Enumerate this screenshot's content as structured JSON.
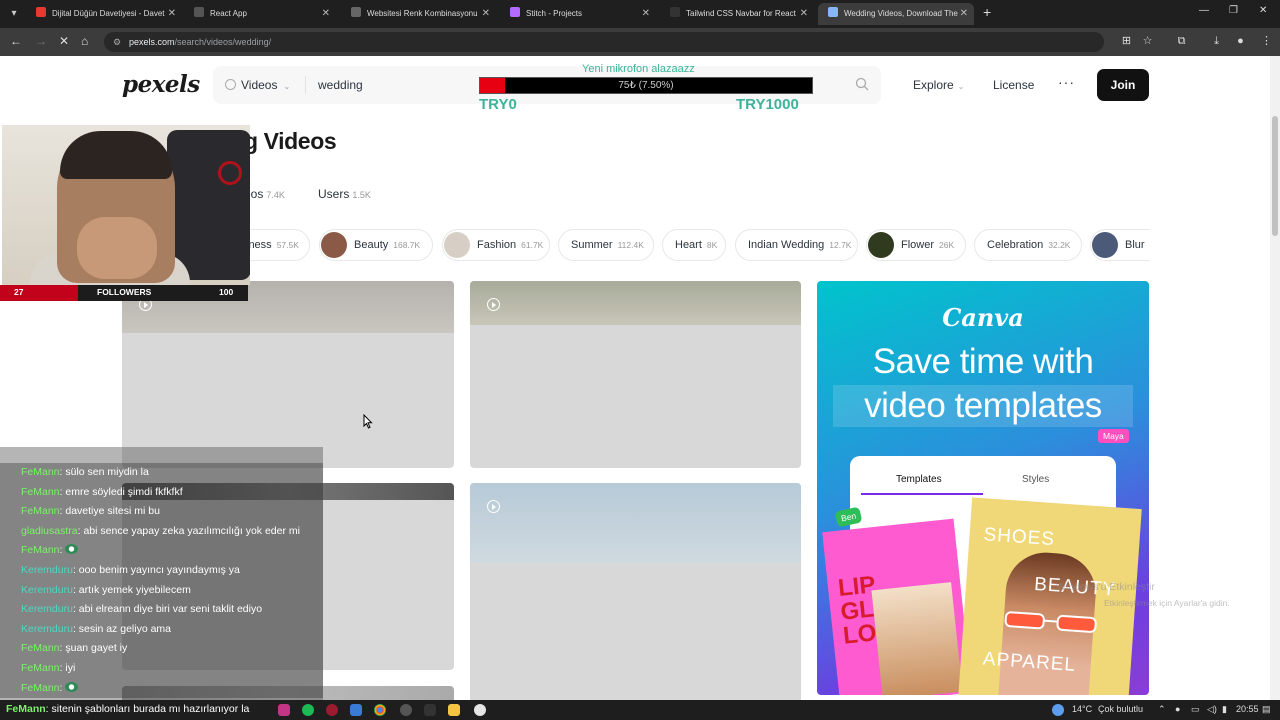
{
  "browser": {
    "tabs": [
      {
        "title": "Dijital Düğün Davetiyesi - Davet",
        "color": "#e53935",
        "active": false
      },
      {
        "title": "React App",
        "color": "#555555",
        "active": false
      },
      {
        "title": "Websitesi Renk Kombinasyonu",
        "color": "#666666",
        "active": false
      },
      {
        "title": "Stitch - Projects",
        "color": "#b36bff",
        "active": false
      },
      {
        "title": "Tailwind CSS Navbar for React",
        "color": "#333333",
        "active": false
      },
      {
        "title": "Wedding Videos, Download The",
        "color": "#8ab4f8",
        "active": true
      }
    ],
    "url_host": "pexels.com",
    "url_path": "/search/videos/wedding/"
  },
  "header": {
    "logo": "pexels",
    "search_type": "Videos",
    "search_query": "wedding",
    "explore": "Explore",
    "license": "License",
    "more": "···",
    "join": "Join"
  },
  "page": {
    "title_fragment": "g Videos",
    "tab_videos_fragment": "eos",
    "tab_videos_count": "7.4K",
    "tab_users": "Users",
    "tab_users_count": "1.5K"
  },
  "chips": [
    {
      "label": "iness",
      "count": "57.5K",
      "thumb": null
    },
    {
      "label": "Beauty",
      "count": "168.7K",
      "thumb": "#8b5a46"
    },
    {
      "label": "Fashion",
      "count": "61.7K",
      "thumb": "#d7cfc6"
    },
    {
      "label": "Summer",
      "count": "112.4K",
      "thumb": null
    },
    {
      "label": "Heart",
      "count": "8K",
      "thumb": null
    },
    {
      "label": "Indian Wedding",
      "count": "12.7K",
      "thumb": null
    },
    {
      "label": "Flower",
      "count": "26K",
      "thumb": "#2f3a1e"
    },
    {
      "label": "Celebration",
      "count": "32.2K",
      "thumb": null
    },
    {
      "label": "Blur",
      "count": "",
      "thumb": "#4a5a78"
    }
  ],
  "ad": {
    "brand": "Canva",
    "headline_1": "Save time with",
    "headline_2": "video templates",
    "maya_tag": "Maya",
    "tab_templates": "Templates",
    "tab_styles": "Styles",
    "ben_tag": "Ben",
    "pink_text": "LIP GLOSS LO",
    "yellow_1": "SHOES",
    "yellow_2": "BEAUTY",
    "yellow_3": "APPAREL"
  },
  "watermark": {
    "line1": "Windows'u Etkinleştir",
    "line2": "Etkinleştirmek için Ayarlar'a gidin."
  },
  "stream": {
    "goal_title": "Yeni mikrofon alazaazz",
    "goal_progress": "75₺ (7.50%)",
    "goal_fraction": 0.075,
    "goal_min": "TRY0",
    "goal_max": "TRY1000",
    "followers_min": "27",
    "followers_label": "FOLLOWERS",
    "followers_max": "100"
  },
  "chat": [
    {
      "user": "FeMann",
      "msg": ": sülo sen miydin la",
      "alt": false
    },
    {
      "user": "FeMann",
      "msg": ": emre söyledi şimdi fkfkfkf",
      "alt": false
    },
    {
      "user": "FeMann",
      "msg": ": davetiye sitesi mi bu",
      "alt": false
    },
    {
      "user": "gladiusastra",
      "msg": ": abi sence yapay zeka yazılımcılığı yok eder mi",
      "alt": false
    },
    {
      "user": "FeMann",
      "msg": ":",
      "alt": false,
      "badge": true
    },
    {
      "user": "Keremduru",
      "msg": ": ooo benim yayıncı yayındaymış ya",
      "alt": true
    },
    {
      "user": "Keremduru",
      "msg": ": artık yemek yiyebilecem",
      "alt": true
    },
    {
      "user": "Keremduru",
      "msg": ": abi elreann diye biri var seni taklit ediyo",
      "alt": true
    },
    {
      "user": "Keremduru",
      "msg": ": sesin az geliyo ama",
      "alt": true
    },
    {
      "user": "FeMann",
      "msg": ": şuan gayet iy",
      "alt": false
    },
    {
      "user": "FeMann",
      "msg": ": iyi",
      "alt": false
    },
    {
      "user": "FeMann",
      "msg": ":",
      "alt": false,
      "badge": true
    }
  ],
  "chat_bottom": {
    "user": "FeMann",
    "msg": ": sitenin şablonları burada mı hazırlanıyor la"
  },
  "taskbar": {
    "weather": "14°C",
    "weather_desc": "Çok bulutlu",
    "time": "20:55"
  }
}
